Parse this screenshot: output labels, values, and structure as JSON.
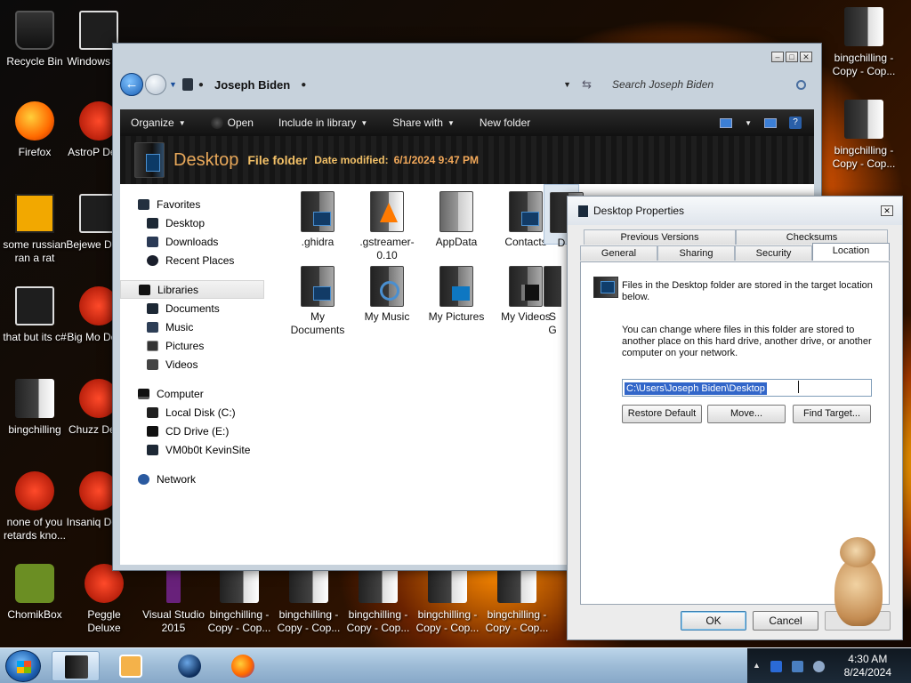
{
  "desktop": {
    "icons": [
      "Recycle Bin",
      "Windows Mai",
      "Firefox",
      "AstroP Delux",
      "some russian ran a rat",
      "Bejewe Delux",
      "that but its c#",
      "Big Mo Delux",
      "bingchilling",
      "Chuzz Delux",
      "none of you retards kno...",
      "Insaniq Delux",
      "ChomikBox",
      "Peggle Deluxe",
      "Visual Studio 2015",
      "bingchilling - Copy - Cop..."
    ]
  },
  "explorer": {
    "breadcrumb": "Joseph Biden",
    "search_placeholder": "Search Joseph Biden",
    "toolbar": {
      "organize": "Organize",
      "open": "Open",
      "include": "Include in library",
      "share": "Share with",
      "new_folder": "New folder"
    },
    "header": {
      "title": "Desktop",
      "type": "File folder",
      "date_label": "Date modified:",
      "date_value": "6/1/2024 9:47 PM"
    },
    "nav": {
      "favorites": "Favorites",
      "desktop": "Desktop",
      "downloads": "Downloads",
      "recent": "Recent Places",
      "libraries": "Libraries",
      "documents": "Documents",
      "music": "Music",
      "pictures": "Pictures",
      "videos": "Videos",
      "computer": "Computer",
      "local_disk": "Local Disk (C:)",
      "cd_drive": "CD Drive (E:)",
      "vm": "VM0b0t KevinSite",
      "network": "Network"
    },
    "files": [
      ".ghidra",
      ".gstreamer-0.10",
      "AppData",
      "Contacts",
      "D",
      "My Documents",
      "My Music",
      "My Pictures",
      "My Videos",
      "S G"
    ]
  },
  "properties": {
    "title": "Desktop Properties",
    "tabs_row1": [
      "Previous Versions",
      "Checksums"
    ],
    "tabs_row2": [
      "General",
      "Sharing",
      "Security",
      "Location"
    ],
    "info": "Files in the Desktop folder are stored in the target location below.",
    "desc": "You can change where files in this folder are stored to another place on this hard drive, another drive, or another computer on your network.",
    "path": "C:\\Users\\Joseph Biden\\Desktop",
    "buttons": {
      "restore": "Restore Default",
      "move": "Move...",
      "find": "Find Target...",
      "ok": "OK",
      "cancel": "Cancel"
    }
  },
  "taskbar": {
    "time": "4:30 AM",
    "date": "8/24/2024"
  }
}
